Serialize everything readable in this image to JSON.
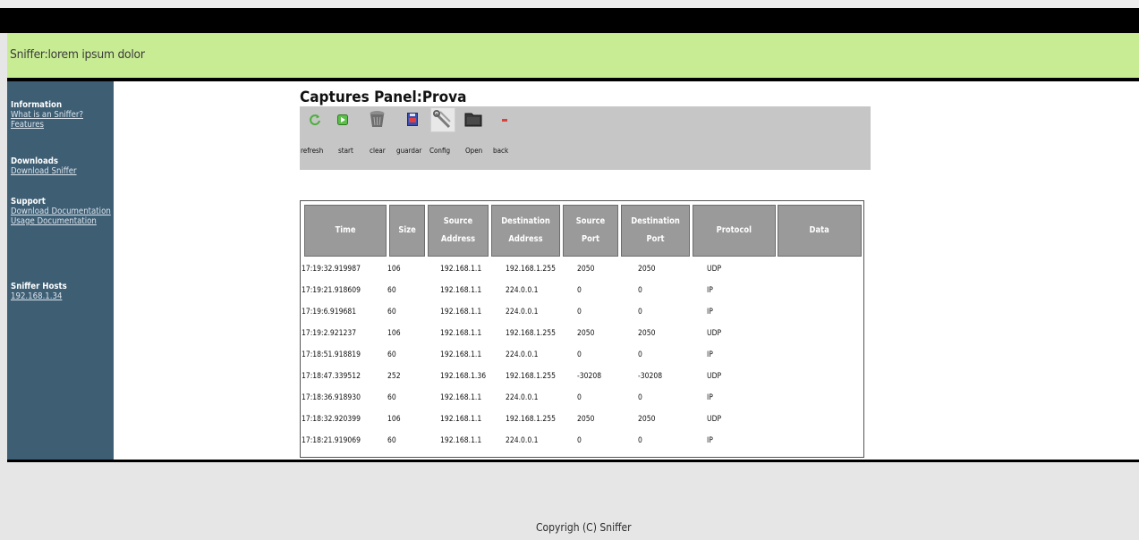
{
  "header": {
    "title": "Sniffer:lorem ipsum dolor"
  },
  "sidebar": {
    "groups": [
      {
        "heading": "Information",
        "links": [
          "What is an Sniffer?",
          "Features"
        ]
      },
      {
        "heading": "Downloads",
        "links": [
          "Download Sniffer"
        ]
      },
      {
        "heading": "Support",
        "links": [
          "Download Documentation",
          "Usage Documentation"
        ]
      },
      {
        "heading": "Sniffer Hosts",
        "links": [
          "192.168.1.34"
        ]
      }
    ]
  },
  "panel": {
    "title": "Captures Panel:Prova"
  },
  "toolbar": {
    "buttons": [
      {
        "label": "refresh",
        "icon": "refresh-icon"
      },
      {
        "label": "start",
        "icon": "play-icon"
      },
      {
        "label": "clear",
        "icon": "trash-icon"
      },
      {
        "label": "guardar",
        "icon": "save-icon"
      },
      {
        "label": "Config",
        "icon": "tools-icon"
      },
      {
        "label": "Open",
        "icon": "folder-icon"
      },
      {
        "label": "back",
        "icon": "minus-icon"
      }
    ]
  },
  "table": {
    "columns": [
      "Time",
      "Size",
      "Source Address",
      "Destination Address",
      "Source Port",
      "Destination Port",
      "Protocol",
      "Data"
    ],
    "rows": [
      [
        "17:19:32.919987",
        "106",
        "192.168.1.1",
        "192.168.1.255",
        "2050",
        "2050",
        "UDP",
        ""
      ],
      [
        "17:19:21.918609",
        "60",
        "192.168.1.1",
        "224.0.0.1",
        "0",
        "0",
        "IP",
        ""
      ],
      [
        "17:19:6.919681",
        "60",
        "192.168.1.1",
        "224.0.0.1",
        "0",
        "0",
        "IP",
        ""
      ],
      [
        "17:19:2.921237",
        "106",
        "192.168.1.1",
        "192.168.1.255",
        "2050",
        "2050",
        "UDP",
        ""
      ],
      [
        "17:18:51.918819",
        "60",
        "192.168.1.1",
        "224.0.0.1",
        "0",
        "0",
        "IP",
        ""
      ],
      [
        "17:18:47.339512",
        "252",
        "192.168.1.36",
        "192.168.1.255",
        "-30208",
        "-30208",
        "UDP",
        ""
      ],
      [
        "17:18:36.918930",
        "60",
        "192.168.1.1",
        "224.0.0.1",
        "0",
        "0",
        "IP",
        ""
      ],
      [
        "17:18:32.920399",
        "106",
        "192.168.1.1",
        "192.168.1.255",
        "2050",
        "2050",
        "UDP",
        ""
      ],
      [
        "17:18:21.919069",
        "60",
        "192.168.1.1",
        "224.0.0.1",
        "0",
        "0",
        "IP",
        ""
      ]
    ]
  },
  "footer": {
    "text": "Copyrigh (C) Sniffer"
  },
  "colors": {
    "header_bg": "#c8ec94",
    "sidebar_bg": "#3e5e74",
    "toolbar_bg": "#c6c6c6",
    "table_header_bg": "#9a9a9a"
  }
}
